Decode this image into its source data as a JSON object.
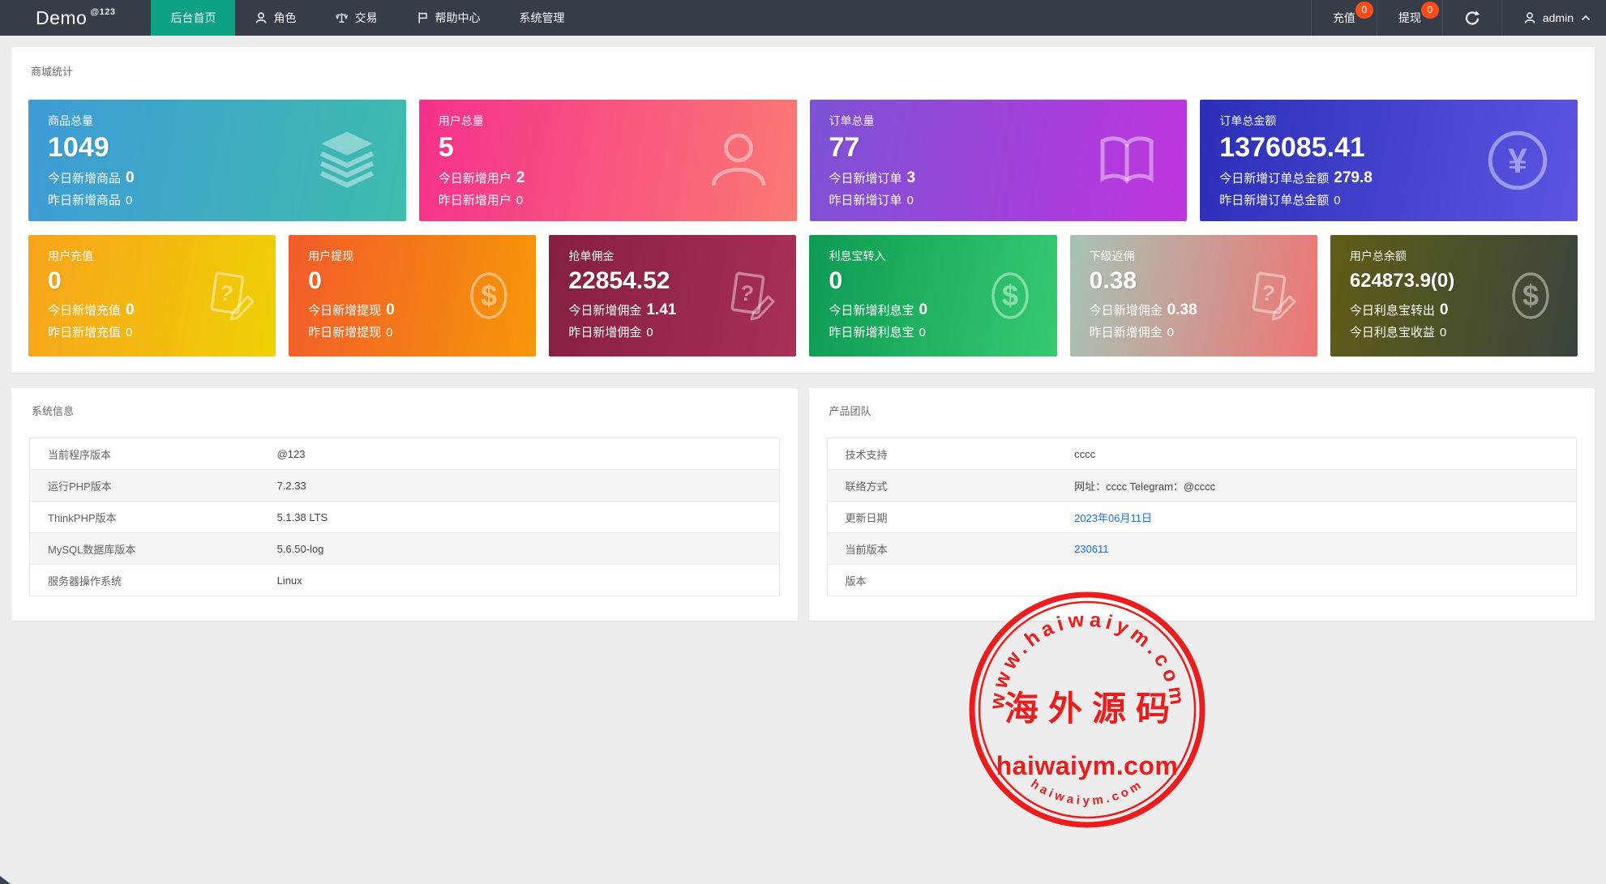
{
  "colors": {
    "accent": "#0fa185",
    "badge": "#ff4c1b",
    "link": "#1a6fe8",
    "stamp": "#ee1111",
    "navbar_bg": "#373d48"
  },
  "navbar": {
    "brand": "Demo",
    "brand_sup": "@123",
    "menu": [
      {
        "label": "后台首页",
        "active": true
      },
      {
        "label": "角色"
      },
      {
        "label": "交易"
      },
      {
        "label": "帮助中心"
      },
      {
        "label": "系统管理"
      }
    ],
    "recharge_label": "充值",
    "recharge_badge": "0",
    "withdraw_label": "提现",
    "withdraw_badge": "0",
    "username": "admin"
  },
  "stats": {
    "section_title": "商城统计",
    "row1": [
      {
        "title": "商品总量",
        "value": "1049",
        "line2_label": "今日新增商品",
        "line2_value": "0",
        "line3_label": "昨日新增商品",
        "line3_value": "0",
        "icon": "layers-icon",
        "g1": "#3e9bd8",
        "g2": "#3ebcab"
      },
      {
        "title": "用户总量",
        "value": "5",
        "line2_label": "今日新增用户",
        "line2_value": "2",
        "line3_label": "昨日新增用户",
        "line3_value": "0",
        "icon": "user-icon",
        "g1": "#f5308c",
        "g2": "#fa7a72"
      },
      {
        "title": "订单总量",
        "value": "77",
        "line2_label": "今日新增订单",
        "line2_value": "3",
        "line3_label": "昨日新增订单",
        "line3_value": "0",
        "icon": "book-icon",
        "g1": "#7c52d4",
        "g2": "#bf35de"
      },
      {
        "title": "订单总金额",
        "value": "1376085.41",
        "line2_label": "今日新增订单总金额",
        "line2_value": "279.8",
        "line3_label": "昨日新增订单总金额",
        "line3_value": "0",
        "icon": "yen-icon",
        "g1": "#2a2fb8",
        "g2": "#5d55e2"
      }
    ],
    "row2": [
      {
        "title": "用户充值",
        "value": "0",
        "line2_label": "今日新增充值",
        "line2_value": "0",
        "line3_label": "昨日新增充值",
        "line3_value": "0",
        "icon": "doc-question-icon",
        "g1": "#f8a41c",
        "g2": "#eed004"
      },
      {
        "title": "用户提现",
        "value": "0",
        "line2_label": "今日新增提现",
        "line2_value": "0",
        "line3_label": "昨日新增提现",
        "line3_value": "0",
        "icon": "dollar-icon",
        "g1": "#f25b2a",
        "g2": "#f69708"
      },
      {
        "title": "抢单佣金",
        "value": "22854.52",
        "line2_label": "今日新增佣金",
        "line2_value": "1.41",
        "line3_label": "昨日新增佣金",
        "line3_value": "0",
        "icon": "doc-question-icon",
        "g1": "#851f41",
        "g2": "#a93055"
      },
      {
        "title": "利息宝转入",
        "value": "0",
        "line2_label": "今日新增利息宝",
        "line2_value": "0",
        "line3_label": "昨日新增利息宝",
        "line3_value": "0",
        "icon": "dollar-icon",
        "g1": "#0d9b52",
        "g2": "#36ca72"
      },
      {
        "title": "下级返佣",
        "value": "0.38",
        "line2_label": "今日新增佣金",
        "line2_value": "0.38",
        "line3_label": "昨日新增佣金",
        "line3_value": "0",
        "icon": "doc-question-icon",
        "g1": "#a7c4b5",
        "g2": "#ee7573"
      },
      {
        "title": "用户总余额",
        "value": "624873.9(0)",
        "line2_label": "今日利息宝转出",
        "line2_value": "0",
        "line3_label": "今日利息宝收益",
        "line3_value": "0",
        "icon": "dollar-icon",
        "g1": "#5f5d17",
        "g2": "#3a443c"
      }
    ]
  },
  "system_info": {
    "title": "系统信息",
    "rows": [
      {
        "label": "当前程序版本",
        "value": "@123"
      },
      {
        "label": "运行PHP版本",
        "value": "7.2.33"
      },
      {
        "label": "ThinkPHP版本",
        "value": "5.1.38 LTS"
      },
      {
        "label": "MySQL数据库版本",
        "value": "5.6.50-log"
      },
      {
        "label": "服务器操作系统",
        "value": "Linux"
      }
    ]
  },
  "product_team": {
    "title": "产品团队",
    "rows": [
      {
        "label": "技术支持",
        "value": "cccc"
      },
      {
        "label": "联络方式",
        "value": "网址：cccc Telegram：@cccc"
      },
      {
        "label": "更新日期",
        "value": "2023年06月11日"
      },
      {
        "label": "当前版本",
        "value": "230611"
      },
      {
        "label": "版本",
        "value": ""
      }
    ]
  },
  "watermark": {
    "arc_top": "www.haiwaiym.com",
    "center": "海外源码",
    "main": "haiwaiym.com",
    "arc_bottom": "haiwaiym.com"
  }
}
